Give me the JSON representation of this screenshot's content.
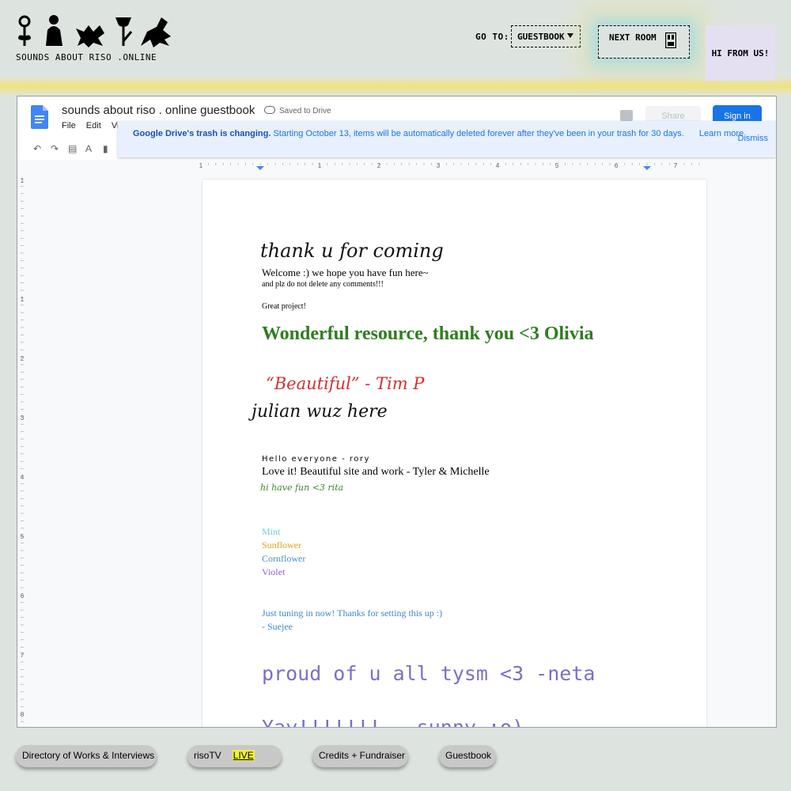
{
  "site": {
    "name": "SOUNDS ABOUT RISO .ONLINE",
    "goto_label": "GO TO:",
    "goto_value": "GUESTBOOK",
    "next_room": "NEXT ROOM",
    "hi_button": "HI FROM US!"
  },
  "docs": {
    "title": "sounds about riso . online guestbook",
    "saved_status": "Saved to Drive",
    "menu": [
      "File",
      "Edit",
      "Vi"
    ],
    "share": "Share",
    "sign_in": "Sign in",
    "banner": {
      "bold": "Google Drive's trash is changing.",
      "text": "Starting October 13, items will be automatically deleted forever after they've been in your trash for 30 days.",
      "learn_more": "Learn more",
      "dismiss": "Dismiss"
    },
    "ruler_numbers": [
      "1",
      "1",
      "2",
      "3",
      "4",
      "5",
      "6",
      "7"
    ],
    "vruler_numbers": [
      "1",
      "1",
      "2",
      "3",
      "4",
      "5",
      "6",
      "7",
      "8"
    ]
  },
  "guestbook": {
    "thanks": "thank u for coming",
    "welcome": "Welcome :) we hope you have fun here~",
    "no_delete": "and plz do not delete any comments!!!",
    "great": "Great project!",
    "olivia": "Wonderful resource, thank you <3 Olivia",
    "tim": "“Beautiful” - Tim P",
    "julian": "julian wuz here",
    "rory": "Hello everyone - rory",
    "tyler": "Love it! Beautiful site and work - Tyler & Michelle",
    "rita": "hi have fun <3 rita",
    "mint": "Mint",
    "sunflower": "Sunflower",
    "cornflower": "Cornflower",
    "violet": "Violet",
    "suejee": "Just tuning in now! Thanks for setting this up :)",
    "suejee_name": "- Suejee",
    "neta": "proud of u all tysm <3 -neta",
    "sunny": "Yay!!!!!!! - sunny :o)"
  },
  "nav": {
    "directory": "Directory of Works & Interviews",
    "risotv": "risoTV",
    "live": "LIVE",
    "credits": "Credits + Fundraiser",
    "guestbook": "Guestbook"
  },
  "colors": {
    "background": "#dde4df",
    "docs_blue": "#1a73e8",
    "olivia_green": "#2e7d20",
    "tim_red": "#d62f2f",
    "violet_mono": "#7c6ec7"
  }
}
